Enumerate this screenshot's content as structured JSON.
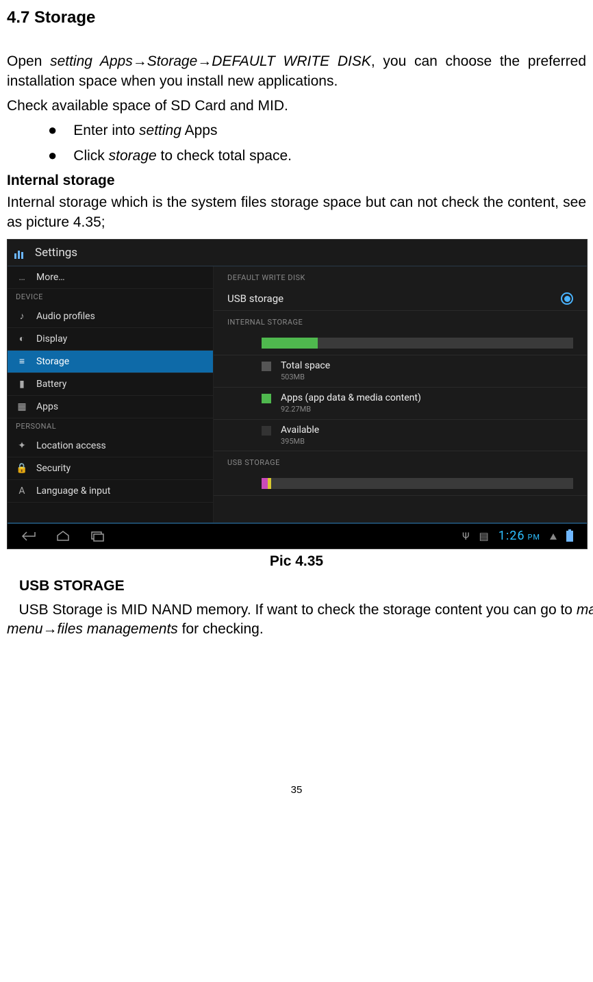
{
  "heading": "4.7 Storage",
  "p1": {
    "open": "Open ",
    "setting_apps": "setting Apps",
    "arrow": "→",
    "storage": "Storage",
    "default_w_d": "DEFAULT WRITE DISK",
    "rest": ", you can choose the preferred installation space when you install new applications."
  },
  "p2": "Check available space of SD Card and MID.",
  "bullets": {
    "b1_pre": "Enter into ",
    "b1_it": "setting",
    "b1_post": " Apps",
    "b2_pre": "Click ",
    "b2_it": "storage",
    "b2_post": " to check total space."
  },
  "internal_head": "Internal storage",
  "internal_para": "Internal storage which is the system files storage space but can not check the content, see as picture 4.35;",
  "screenshot": {
    "header": "Settings",
    "left": {
      "more": "More…",
      "cat_device": "DEVICE",
      "audio": "Audio profiles",
      "display": "Display",
      "storage": "Storage",
      "battery": "Battery",
      "apps": "Apps",
      "cat_personal": "PERSONAL",
      "location": "Location access",
      "security": "Security",
      "language": "Language & input"
    },
    "right": {
      "cat_default": "DEFAULT WRITE DISK",
      "usb_storage_opt": "USB storage",
      "cat_internal": "INTERNAL STORAGE",
      "total": "Total space",
      "total_sub": "503MB",
      "apps": "Apps (app data & media content)",
      "apps_sub": "92.27MB",
      "avail": "Available",
      "avail_sub": "395MB",
      "cat_usb": "USB STORAGE"
    },
    "clock": "1:26",
    "clock_ampm": "PM"
  },
  "caption": "Pic 4.35",
  "usb_head": "USB STORAGE",
  "usb_para": {
    "lead": "   USB Storage is MID NAND memory. If want to check the storage content you can go to ",
    "it1": "main menu",
    "arrow": "→",
    "it2": "files managements",
    "tail": " for checking."
  },
  "page_num": "35"
}
